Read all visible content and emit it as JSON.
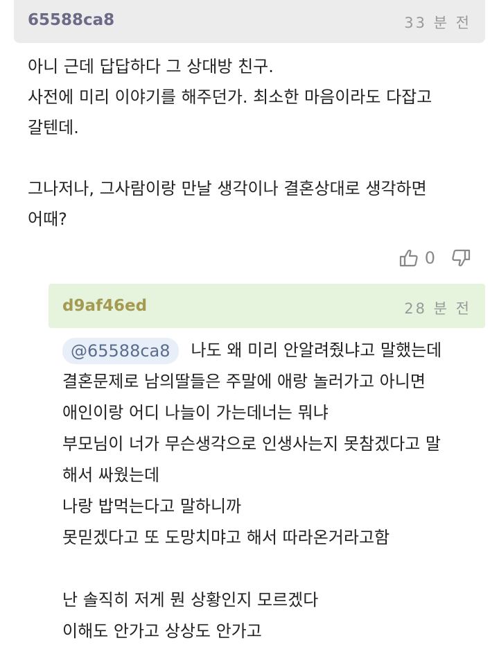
{
  "comment1": {
    "author": "65588ca8",
    "time": "33 분 전",
    "lines": [
      "아니 근데 답답하다 그 상대방 친구.",
      "사전에 미리 이야기를 해주던가. 최소한 마음이라도 다잡고",
      "갈텐데.",
      "",
      "그나저나, 그사람이랑 만날 생각이나 결혼상대로 생각하면",
      "어때?"
    ],
    "votes": {
      "upvote_icon": "thumbs-up-icon",
      "upvote_count": "0",
      "downvote_icon": "thumbs-down-icon"
    }
  },
  "comment2": {
    "author": "d9af46ed",
    "time": "28 분 전",
    "mention": "@65588ca8",
    "first_line": "나도 왜 미리 안알려줬냐고 말했는데",
    "lines": [
      "결혼문제로 남의딸들은 주말에 애랑 놀러가고 아니면",
      "애인이랑 어디 나늘이 가는데너는 뭐냐",
      "부모님이 너가 무슨생각으로 인생사는지 못참겠다고 말",
      "해서 싸웠는데",
      "나랑 밥먹는다고 말하니까",
      "못믿겠다고 또 도망치먀고 해서 따라온거라고함",
      "",
      "난 솔직히 저게 뭔 상황인지 모르겠다",
      "이해도 안가고 상상도 안가고"
    ]
  },
  "colors": {
    "comment1_header_bg": "#ececec",
    "comment2_header_bg": "#e6f4dd",
    "author1": "#6b6b88",
    "author2": "#a59a52",
    "mention_bg": "#e9eff8"
  }
}
